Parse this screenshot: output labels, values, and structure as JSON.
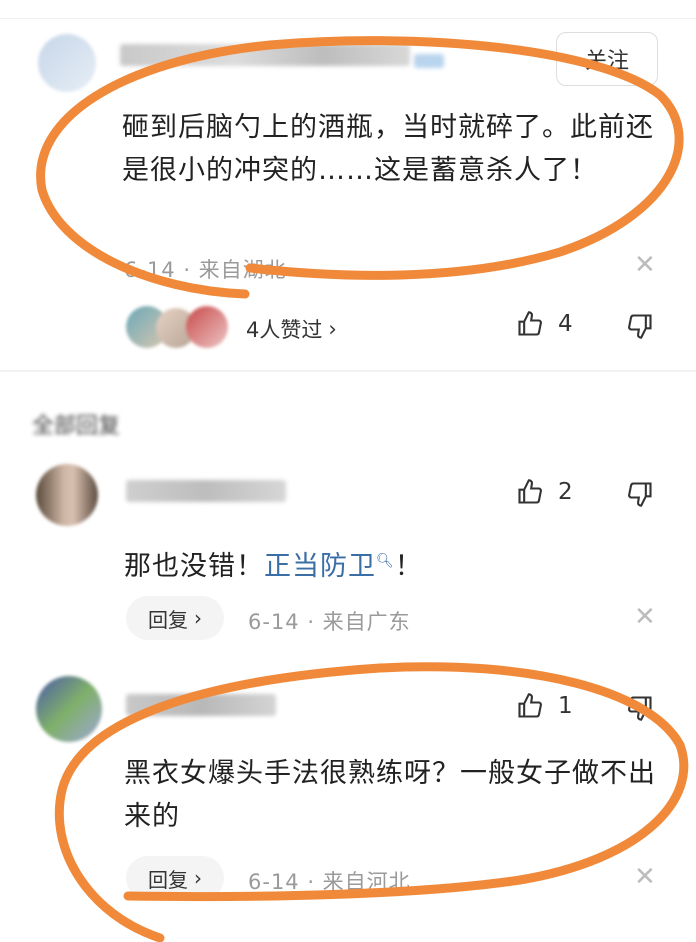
{
  "comment1": {
    "follow_label": "关注",
    "text": "砸到后脑勺上的酒瓶，当时就碎了。此前还是很小的冲突的……这是蓄意杀人了！",
    "meta": "6-14 · 来自湖北",
    "likers_text": "4人赞过",
    "like_count": "4"
  },
  "section_label": "全部回复",
  "comment2": {
    "text_main": "那也没错！",
    "link": "正当防卫",
    "text_end": "！",
    "reply_label": "回复",
    "meta": "6-14 · 来自广东",
    "like_count": "2"
  },
  "comment3": {
    "text": "黑衣女爆头手法很熟练呀？一般女子做不出来的",
    "reply_label": "回复",
    "meta": "6-14 · 来自河北",
    "like_count": "1"
  },
  "colors": {
    "annotation": "#f08a3a",
    "link": "#3b6ea5",
    "meta": "#9a9a9a"
  },
  "icons": [
    "close-icon",
    "thumb-up-icon",
    "thumb-down-icon",
    "chevron-right-icon",
    "search-icon"
  ]
}
